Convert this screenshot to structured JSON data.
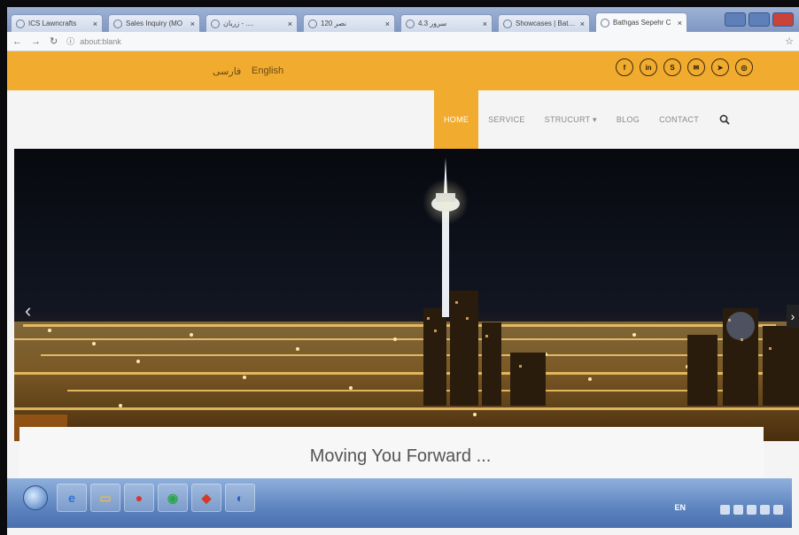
{
  "browser": {
    "tabs": [
      {
        "title": "ICS Lawncrafts"
      },
      {
        "title": "Sales Inquiry (MO"
      },
      {
        "title": "ز‌ربان - ...."
      },
      {
        "title": "نصر 120"
      },
      {
        "title": "سرور 4.3"
      },
      {
        "title": "Showcases | Bathroy"
      },
      {
        "title": "Bathgas Sepehr C"
      }
    ],
    "url": "about:blank"
  },
  "topbar": {
    "lang_fa": "فارسی",
    "lang_en": "English",
    "socials": [
      {
        "icon": "facebook-icon",
        "glyph": "f"
      },
      {
        "icon": "linkedin-icon",
        "glyph": "in"
      },
      {
        "icon": "skype-icon",
        "glyph": "S"
      },
      {
        "icon": "email-icon",
        "glyph": "✉"
      },
      {
        "icon": "telegram-icon",
        "glyph": "➤"
      },
      {
        "icon": "instagram-icon",
        "glyph": "◎"
      }
    ]
  },
  "nav": {
    "items": [
      {
        "label": "HOME"
      },
      {
        "label": "SERVICE"
      },
      {
        "label": "STRUCURT ▾"
      },
      {
        "label": "BLOG"
      },
      {
        "label": "CONTACT"
      }
    ]
  },
  "hero": {
    "caption": "Moving You Forward ..."
  },
  "taskbar": {
    "tray_lang": "EN"
  },
  "colors": {
    "accent": "#f1ab2e",
    "header_bg": "#f4f4f4"
  }
}
